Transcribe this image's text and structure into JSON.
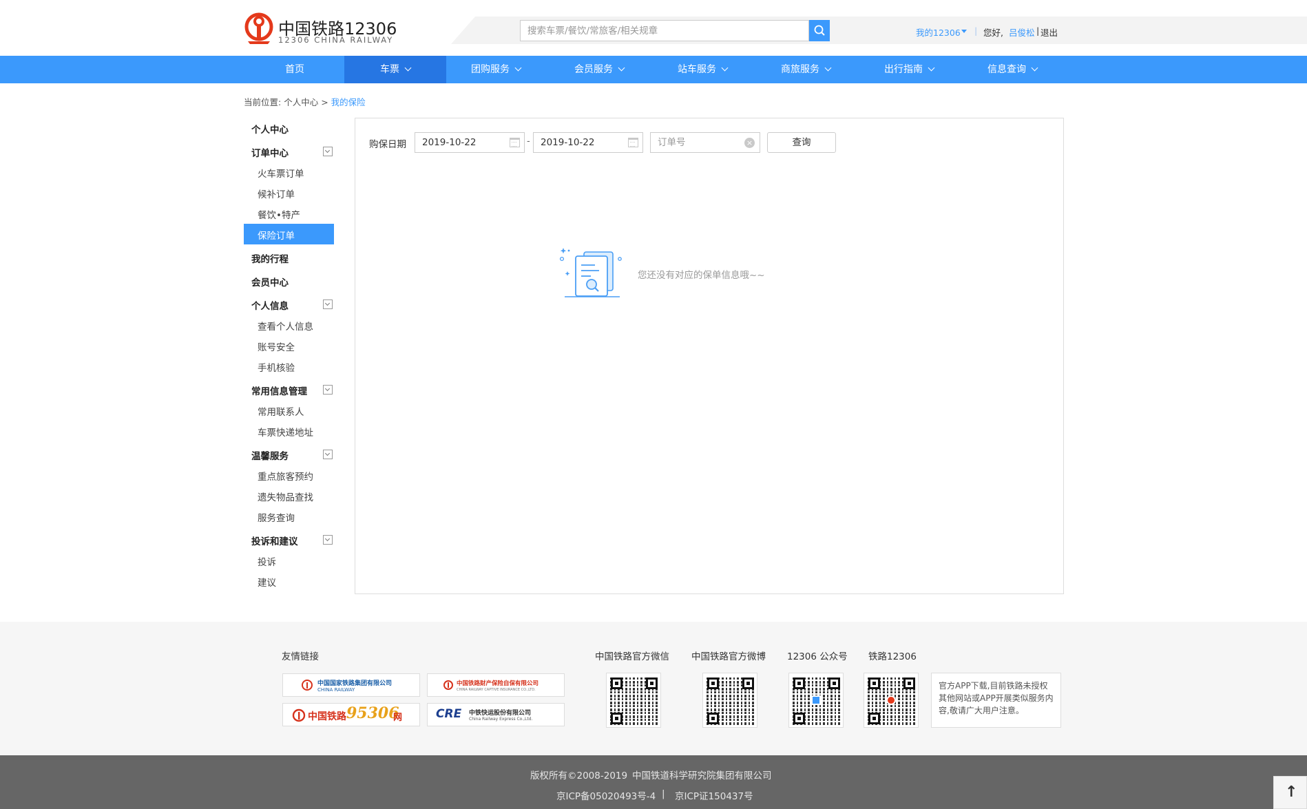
{
  "brand": {
    "title": "中国铁路12306",
    "subtitle": "12306 CHINA RAILWAY",
    "accent_color": "#3b99fc",
    "logo_color": "#e4391b"
  },
  "search": {
    "placeholder": "搜索车票/餐饮/常旅客/相关规章",
    "icon": "search-icon"
  },
  "top_links": {
    "my12306": "我的12306",
    "separator": "|",
    "greeting": "您好,",
    "username": "吕俊松",
    "pipe": "|",
    "logout": "退出"
  },
  "nav": {
    "items": [
      {
        "label": "首页"
      },
      {
        "label": "车票"
      },
      {
        "label": "团购服务"
      },
      {
        "label": "会员服务"
      },
      {
        "label": "站车服务"
      },
      {
        "label": "商旅服务"
      },
      {
        "label": "出行指南"
      },
      {
        "label": "信息查询"
      }
    ],
    "active_index": 1
  },
  "breadcrumb": {
    "prefix": "当前位置:",
    "parent": "个人中心",
    "sep": ">",
    "current": "我的保险"
  },
  "sidebar": {
    "personal_center": "个人中心",
    "order_center": {
      "label": "订单中心",
      "items": [
        "火车票订单",
        "候补订单",
        "餐饮•特产",
        "保险订单"
      ]
    },
    "my_trips": "我的行程",
    "member_center": "会员中心",
    "personal_info": {
      "label": "个人信息",
      "items": [
        "查看个人信息",
        "账号安全",
        "手机核验"
      ]
    },
    "common_info": {
      "label": "常用信息管理",
      "items": [
        "常用联系人",
        "车票快递地址"
      ]
    },
    "warm_service": {
      "label": "温馨服务",
      "items": [
        "重点旅客预约",
        "遗失物品查找",
        "服务查询"
      ]
    },
    "complaints": {
      "label": "投诉和建议",
      "items": [
        "投诉",
        "建议"
      ]
    }
  },
  "filter": {
    "label": "购保日期",
    "start_date": "2019-10-22",
    "dash": "-",
    "end_date": "2019-10-22",
    "order_placeholder": "订单号",
    "query_button": "查询"
  },
  "empty_state": {
    "message": "您还没有对应的保单信息哦~~",
    "icon": "document-search-icon"
  },
  "footer": {
    "friend_links_title": "友情链接",
    "partners": [
      {
        "name": "中国国家铁路集团有限公司",
        "sub": "CHINA RAILWAY"
      },
      {
        "name": "中国铁路财产保险自保有限公司",
        "sub": "CHINA RAILWAY CAPTIVE INSURANCE CO.,LTD."
      },
      {
        "name": "中国铁路",
        "brand": "95306",
        "suffix": "网"
      },
      {
        "name": "中铁快运股份有限公司",
        "brand": "CRE",
        "sub": "China Railway Express Co.,Ltd."
      }
    ],
    "qr": [
      {
        "title": "中国铁路官方微信"
      },
      {
        "title": "中国铁路官方微博"
      },
      {
        "title": "12306 公众号"
      },
      {
        "title": "铁路12306"
      }
    ],
    "app_note": "官方APP下载,目前铁路未授权其他网站或APP开展类似服务内容,敬请广大用户注意。"
  },
  "bottom_bar": {
    "copyright": "版权所有©2008-2019",
    "org": "中国铁道科学研究院集团有限公司",
    "icp1": "京ICP备05020493号-4",
    "sep": "|",
    "icp2": "京ICP证150437号",
    "to_top": "↑"
  }
}
